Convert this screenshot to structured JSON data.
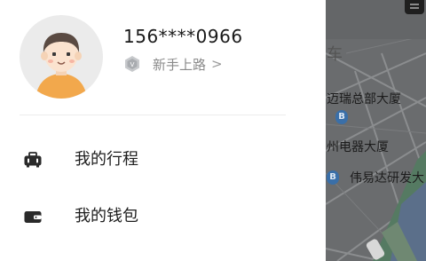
{
  "profile": {
    "phone": "156****0966",
    "level_label": "新手上路",
    "level_chevron": ">"
  },
  "menu": {
    "items": [
      {
        "label": "我的行程",
        "icon": "trip-bag-icon"
      },
      {
        "label": "我的钱包",
        "icon": "wallet-icon"
      }
    ]
  },
  "map": {
    "labels": {
      "car_partial": "车",
      "building_1": "迈瑞总部大厦",
      "building_2": "州电器大厦",
      "building_3": "伟易达研发大"
    }
  },
  "colors": {
    "drawer_bg": "#ffffff",
    "overlay_map": "#6a6c6e",
    "text_primary": "#1a1a1a",
    "text_secondary": "#8a8a8a",
    "pin_blue": "#3a6fa8",
    "avatar_shirt": "#f2a84c"
  }
}
